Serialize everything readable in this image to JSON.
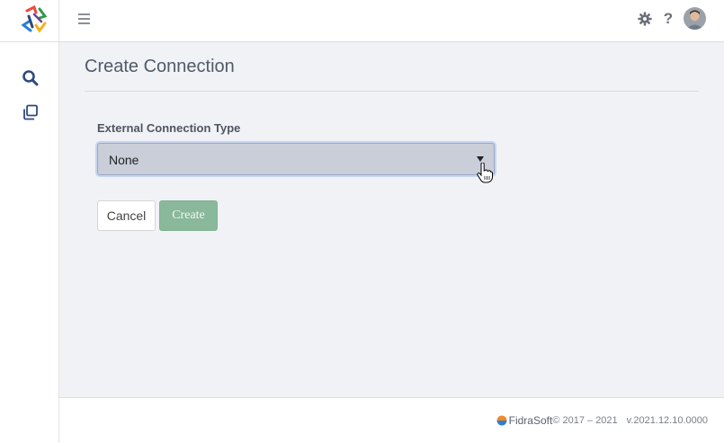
{
  "header": {
    "menu_icon": "hamburger-icon",
    "settings_icon": "gear-icon",
    "help_label": "?",
    "avatar_icon": "user-avatar"
  },
  "sidebar": {
    "items": [
      {
        "icon": "search-icon"
      },
      {
        "icon": "copy-windows-icon"
      }
    ]
  },
  "page": {
    "title": "Create Connection",
    "field_label": "External Connection Type",
    "select_value": "None"
  },
  "actions": {
    "cancel_label": "Cancel",
    "create_label": "Create"
  },
  "footer": {
    "brand": "FidraSoft",
    "copyright": "© 2017 – 2021",
    "version": "v.2021.12.10.0000"
  },
  "colors": {
    "create_button": "#8ab89a",
    "select_bg": "#c9ced8",
    "accent_blue": "#2d4a7a"
  }
}
